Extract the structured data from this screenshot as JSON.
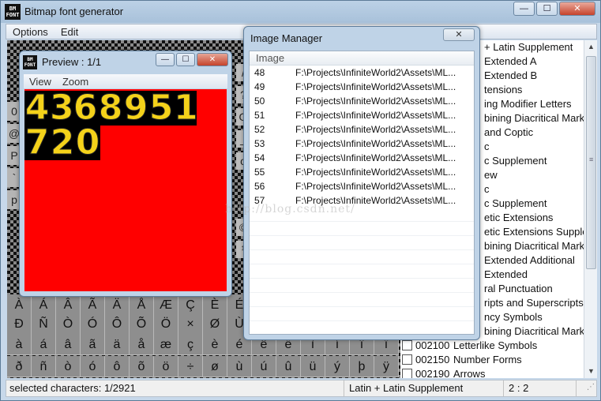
{
  "app": {
    "icon_label": "BM FONT",
    "title": "Bitmap font generator",
    "window_buttons": {
      "minimize": "—",
      "maximize": "☐",
      "close": "✕"
    }
  },
  "menu": [
    "Options",
    "Edit"
  ],
  "char_grid": {
    "rows": [
      [
        "À",
        "Á",
        "Â",
        "Ã",
        "Ä",
        "Å",
        "Æ",
        "Ç",
        "È",
        "É"
      ],
      [
        "Ð",
        "Ñ",
        "Ò",
        "Ó",
        "Ô",
        "Õ",
        "Ö",
        "×",
        "Ø",
        "Ù"
      ],
      [
        "à",
        "á",
        "â",
        "ã",
        "ä",
        "å",
        "æ",
        "ç",
        "è",
        "é",
        "ê",
        "ë",
        "ì",
        "í",
        "î",
        "ï"
      ],
      [
        "ð",
        "ñ",
        "ò",
        "ó",
        "ô",
        "õ",
        "ö",
        "÷",
        "ø",
        "ù",
        "ú",
        "û",
        "ü",
        "ý",
        "þ",
        "ÿ"
      ]
    ],
    "left_edge": [
      "0",
      "@",
      "P",
      "`",
      "p"
    ],
    "right_edge": [
      "/",
      "?",
      "O",
      "_",
      "o",
      "",
      "",
      "©",
      "¹"
    ]
  },
  "subsets": [
    {
      "code": "",
      "name": "+ Latin Supplement",
      "checked": null
    },
    {
      "code": "",
      "name": "Extended A",
      "checked": null
    },
    {
      "code": "",
      "name": "Extended B",
      "checked": null
    },
    {
      "code": "",
      "name": "tensions",
      "checked": null
    },
    {
      "code": "",
      "name": "ing Modifier Letters",
      "checked": null
    },
    {
      "code": "",
      "name": "bining Diacritical Marks",
      "checked": null
    },
    {
      "code": "",
      "name": "and Coptic",
      "checked": null
    },
    {
      "code": "",
      "name": "c",
      "checked": null
    },
    {
      "code": "",
      "name": "c Supplement",
      "checked": null
    },
    {
      "code": "",
      "name": "ew",
      "checked": null
    },
    {
      "code": "",
      "name": "c",
      "checked": null
    },
    {
      "code": "",
      "name": "c Supplement",
      "checked": null
    },
    {
      "code": "",
      "name": "etic Extensions",
      "checked": null
    },
    {
      "code": "",
      "name": "etic Extensions Supple.",
      "checked": null
    },
    {
      "code": "",
      "name": "bining Diacritical Marks",
      "checked": null
    },
    {
      "code": "",
      "name": "Extended Additional",
      "checked": null
    },
    {
      "code": "",
      "name": "Extended",
      "checked": null
    },
    {
      "code": "",
      "name": "ral Punctuation",
      "checked": null
    },
    {
      "code": "",
      "name": "ripts and Superscripts",
      "checked": null
    },
    {
      "code": "",
      "name": "ncy Symbols",
      "checked": null
    },
    {
      "code": "",
      "name": "bining Diacritical Marks",
      "checked": null
    },
    {
      "code": "002100",
      "name": "Letterlike Symbols",
      "checked": false
    },
    {
      "code": "002150",
      "name": "Number Forms",
      "checked": false
    },
    {
      "code": "002190",
      "name": "Arrows",
      "checked": false
    }
  ],
  "status": {
    "selected": "selected characters: 1/2921",
    "subset": "Latin + Latin Supplement",
    "position": "2 : 2"
  },
  "preview": {
    "icon_label": "BM FONT",
    "title": "Preview : 1/1",
    "menu": [
      "View",
      "Zoom"
    ],
    "buttons": {
      "minimize": "—",
      "maximize": "☐",
      "close": "✕"
    },
    "glyph_rows": [
      [
        "4",
        "3",
        "6",
        "8",
        "9",
        "5",
        "1"
      ],
      [
        "7",
        "2",
        "0"
      ]
    ]
  },
  "image_manager": {
    "title": "Image Manager",
    "close": "✕",
    "column": "Image",
    "rows": [
      {
        "id": "48",
        "path": "F:\\Projects\\InfiniteWorld2\\Assets\\ML..."
      },
      {
        "id": "49",
        "path": "F:\\Projects\\InfiniteWorld2\\Assets\\ML..."
      },
      {
        "id": "50",
        "path": "F:\\Projects\\InfiniteWorld2\\Assets\\ML..."
      },
      {
        "id": "51",
        "path": "F:\\Projects\\InfiniteWorld2\\Assets\\ML..."
      },
      {
        "id": "52",
        "path": "F:\\Projects\\InfiniteWorld2\\Assets\\ML..."
      },
      {
        "id": "53",
        "path": "F:\\Projects\\InfiniteWorld2\\Assets\\ML..."
      },
      {
        "id": "54",
        "path": "F:\\Projects\\InfiniteWorld2\\Assets\\ML..."
      },
      {
        "id": "55",
        "path": "F:\\Projects\\InfiniteWorld2\\Assets\\ML..."
      },
      {
        "id": "56",
        "path": "F:\\Projects\\InfiniteWorld2\\Assets\\ML..."
      },
      {
        "id": "57",
        "path": "F:\\Projects\\InfiniteWorld2\\Assets\\ML..."
      }
    ]
  },
  "watermark": "http://blog.csdn.net/"
}
